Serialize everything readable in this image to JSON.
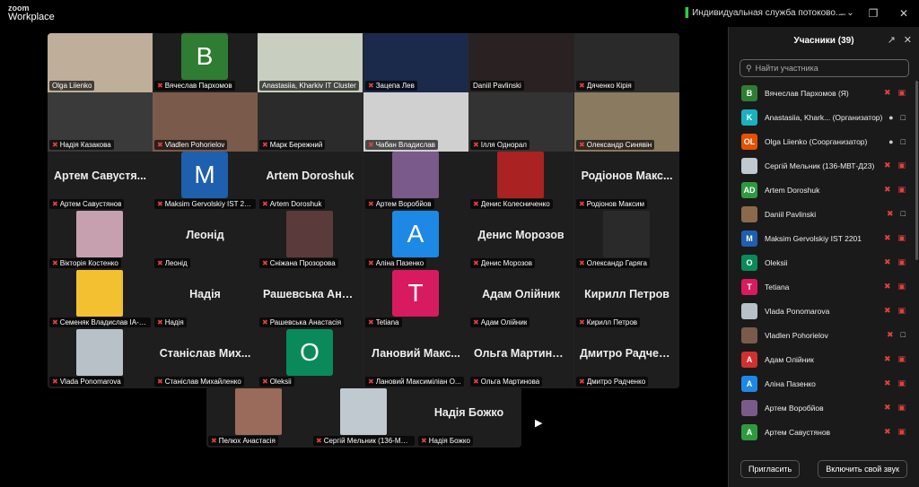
{
  "app": {
    "logo_line1": "zoom",
    "logo_line2": "Workplace",
    "stream_label": "Индивидуальная служба потоково..."
  },
  "tiles": [
    {
      "name": "Olga Liienko",
      "type": "video",
      "bg": "#bfae9a",
      "muted": false
    },
    {
      "name": "Вячеслав Пархомов",
      "type": "avatar",
      "letter": "В",
      "color": "#2e7d32",
      "muted": true
    },
    {
      "name": "Anastasiia, Kharkiv IT Cluster",
      "type": "video",
      "bg": "#c9cfc0",
      "muted": false,
      "active": true
    },
    {
      "name": "Зацепа Лев",
      "type": "video",
      "bg": "#1b2a4a",
      "muted": true
    },
    {
      "name": "Daniil Pavlinski",
      "type": "video",
      "bg": "#2a2222",
      "muted": false
    },
    {
      "name": "Дяченко Кірія",
      "type": "video",
      "bg": "#2a2a2a",
      "muted": true
    },
    {
      "name": "Надія Казакова",
      "type": "video",
      "bg": "#3a3a3a",
      "muted": true
    },
    {
      "name": "Vladlen Pohorielov",
      "type": "video",
      "bg": "#7a5a4a",
      "muted": true
    },
    {
      "name": "Марк Бережний",
      "type": "video",
      "bg": "#2b2b2b",
      "muted": true
    },
    {
      "name": "Чабан Владислав",
      "type": "video",
      "bg": "#d0d0d0",
      "muted": true
    },
    {
      "name": "Ілля Однорал",
      "type": "video",
      "bg": "#333",
      "muted": true
    },
    {
      "name": "Олександр Синявін",
      "type": "video",
      "bg": "#8a7a60",
      "muted": true
    },
    {
      "name": "Артем Савустянов",
      "type": "text",
      "big": "Артем Савустя...",
      "muted": true
    },
    {
      "name": "Maksim Gervolskiy IST 22...",
      "type": "avatar",
      "letter": "M",
      "color": "#1e5fae",
      "muted": true
    },
    {
      "name": "Artem Doroshuk",
      "type": "text",
      "big": "Artem Doroshuk",
      "muted": true
    },
    {
      "name": "Артем Воробйов",
      "type": "photo",
      "bg": "#7a5a8a",
      "muted": true
    },
    {
      "name": "Денис Колесниченко",
      "type": "photo",
      "bg": "#aa2222",
      "muted": true
    },
    {
      "name": "Родіонов Максим",
      "type": "text",
      "big": "Родіонов Макс...",
      "muted": true
    },
    {
      "name": "Вікторія Костенко",
      "type": "photo",
      "bg": "#c7a0b0",
      "muted": true
    },
    {
      "name": "Леонід",
      "type": "text",
      "big": "Леонід",
      "muted": true
    },
    {
      "name": "Сніжана Прозорова",
      "type": "photo",
      "bg": "#5a3a3a",
      "muted": true
    },
    {
      "name": "Аліна Пазенко",
      "type": "avatar",
      "letter": "А",
      "color": "#1e88e5",
      "muted": true
    },
    {
      "name": "Денис Морозов",
      "type": "text",
      "big": "Денис Морозов",
      "muted": true
    },
    {
      "name": "Олександр Гаряга",
      "type": "photo",
      "bg": "#2a2a2a",
      "muted": true
    },
    {
      "name": "Семеняк Владислав ІА-3...",
      "type": "photo",
      "bg": "#f2c030",
      "muted": true
    },
    {
      "name": "Надія",
      "type": "text",
      "big": "Надія",
      "muted": true
    },
    {
      "name": "Рашевська Анастасія",
      "type": "text",
      "big": "Рашевська Ана...",
      "muted": true
    },
    {
      "name": "Tetiana",
      "type": "avatar",
      "letter": "T",
      "color": "#d81b60",
      "muted": true
    },
    {
      "name": "Адам Олійник",
      "type": "text",
      "big": "Адам Олійник",
      "muted": true
    },
    {
      "name": "Кирилл Петров",
      "type": "text",
      "big": "Кирилл Петров",
      "muted": true
    },
    {
      "name": "Vlada Ponomarova",
      "type": "photo",
      "bg": "#b8c0c8",
      "muted": true
    },
    {
      "name": "Станіслав Михайленко",
      "type": "text",
      "big": "Станіслав Мих...",
      "muted": true
    },
    {
      "name": "Oleksii",
      "type": "avatar",
      "letter": "O",
      "color": "#0a8a5a",
      "muted": true
    },
    {
      "name": "Лановий Максиміліан О...",
      "type": "text",
      "big": "Лановий Макс...",
      "muted": true
    },
    {
      "name": "Ольга Мартинова",
      "type": "text",
      "big": "Ольга Мартино...",
      "muted": true
    },
    {
      "name": "Дмитро Радченко",
      "type": "text",
      "big": "Дмитро Радчен...",
      "muted": true
    }
  ],
  "extra_tiles": [
    {
      "name": "Пелюх Анастасія",
      "type": "photo",
      "bg": "#9a6a5a",
      "muted": true
    },
    {
      "name": "Сергій Мельник (136-МВТ-...",
      "type": "photo",
      "bg": "#c0c8d0",
      "muted": true
    },
    {
      "name": "Надія Божко",
      "type": "text",
      "big": "Надія Божко",
      "muted": true
    }
  ],
  "panel": {
    "title": "Учасники (39)",
    "search_placeholder": "Найти участника",
    "invite": "Пригласить",
    "unmute": "Включить свой звук",
    "participants": [
      {
        "name": "Вячеслав Пархомов (Я)",
        "init": "В",
        "color": "#2e7d32",
        "mic": "off",
        "cam": "off"
      },
      {
        "name": "Anastasiia, Khark... (Организатор)",
        "init": "K",
        "color": "#1ab0c0",
        "mic": "on",
        "cam": "on"
      },
      {
        "name": "Olga Liienko (Соорганизатор)",
        "init": "OL",
        "color": "#e65100",
        "mic": "on",
        "cam": "on"
      },
      {
        "name": "Сергій Мельник (136-МВТ-Д23)",
        "init": "",
        "color": "#c0c8d0",
        "mic": "off",
        "cam": "off"
      },
      {
        "name": "Artem Doroshuk",
        "init": "AD",
        "color": "#2e9a40",
        "mic": "off",
        "cam": "off"
      },
      {
        "name": "Daniil Pavlinski",
        "init": "",
        "color": "#8a6a4a",
        "mic": "off",
        "cam": "on"
      },
      {
        "name": "Maksim Gervolskiy IST 2201",
        "init": "M",
        "color": "#1e5fae",
        "mic": "off",
        "cam": "off"
      },
      {
        "name": "Oleksii",
        "init": "O",
        "color": "#0a8a5a",
        "mic": "off",
        "cam": "off"
      },
      {
        "name": "Tetiana",
        "init": "T",
        "color": "#d81b60",
        "mic": "off",
        "cam": "off"
      },
      {
        "name": "Vlada Ponomarova",
        "init": "",
        "color": "#b8c0c8",
        "mic": "off",
        "cam": "off"
      },
      {
        "name": "Vladlen Pohorielov",
        "init": "",
        "color": "#7a5a4a",
        "mic": "off",
        "cam": "on"
      },
      {
        "name": "Адам Олійник",
        "init": "А",
        "color": "#d32f2f",
        "mic": "off",
        "cam": "off"
      },
      {
        "name": "Аліна Пазенко",
        "init": "А",
        "color": "#1e88e5",
        "mic": "off",
        "cam": "off"
      },
      {
        "name": "Артем Воробйов",
        "init": "",
        "color": "#7a5a8a",
        "mic": "off",
        "cam": "off"
      },
      {
        "name": "Артем Савустянов",
        "init": "А",
        "color": "#2e9a40",
        "mic": "off",
        "cam": "off"
      }
    ]
  }
}
